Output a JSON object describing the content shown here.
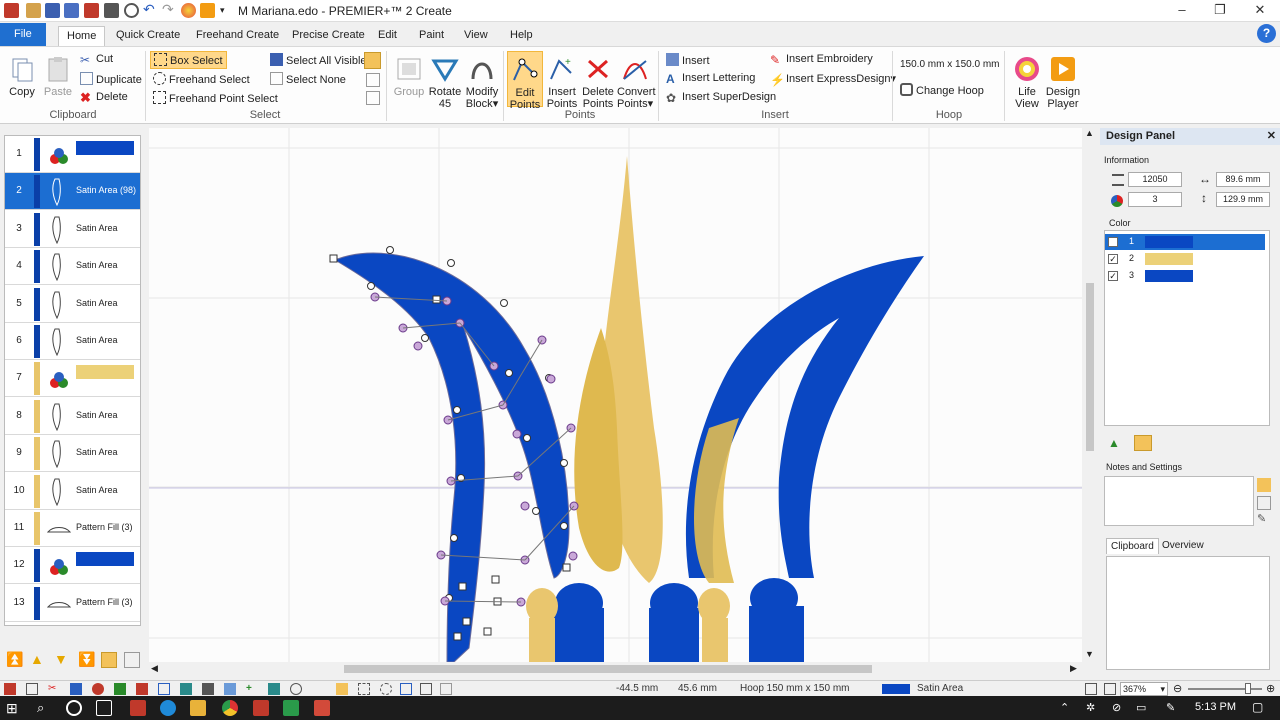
{
  "window": {
    "title": "M Mariana.edo - PREMIER+™ 2 Create",
    "minimize": "–",
    "maximize": "❐",
    "close": "✕"
  },
  "menu": {
    "tabs": [
      "File",
      "Home",
      "Quick Create",
      "Freehand Create",
      "Precise Create",
      "Edit",
      "Paint",
      "View",
      "Help"
    ],
    "help": "?"
  },
  "ribbon": {
    "clipboard": {
      "label": "Clipboard",
      "copy": "Copy",
      "paste": "Paste",
      "cut": "Cut",
      "duplicate": "Duplicate",
      "delete": "Delete"
    },
    "select": {
      "label": "Select",
      "box_select": "Box Select",
      "freehand_select": "Freehand Select",
      "freehand_point_select": "Freehand Point Select",
      "select_all_visible": "Select All Visible",
      "select_none": "Select None"
    },
    "arrange": {
      "group": "Group",
      "rotate45": [
        "Rotate",
        "45"
      ],
      "modify_block": [
        "Modify",
        "Block"
      ]
    },
    "points": {
      "label": "Points",
      "edit_points": [
        "Edit",
        "Points"
      ],
      "insert_points": [
        "Insert",
        "Points"
      ],
      "delete_points": [
        "Delete",
        "Points"
      ],
      "convert_points": [
        "Convert",
        "Points"
      ]
    },
    "insert": {
      "label": "Insert",
      "insert": "Insert",
      "insert_lettering": "Insert Lettering",
      "insert_superdesign": "Insert SuperDesign",
      "insert_embroidery": "Insert Embroidery",
      "insert_expressdesign": "Insert ExpressDesign"
    },
    "hoop": {
      "label": "Hoop",
      "size": "150.0 mm x 150.0 mm",
      "change_hoop": "Change Hoop"
    },
    "life_view": [
      "Life",
      "View"
    ],
    "design_player": [
      "Design",
      "Player"
    ]
  },
  "layers": [
    {
      "num": "1",
      "label": "",
      "bar": "#0a3fa8",
      "swatch": "#0a47c2",
      "type": "color"
    },
    {
      "num": "2",
      "label": "Satin Area (98)",
      "bar": "#0a3fa8",
      "type": "satin",
      "selected": true
    },
    {
      "num": "3",
      "label": "Satin Area",
      "bar": "#0a3fa8",
      "type": "satin"
    },
    {
      "num": "4",
      "label": "Satin Area",
      "bar": "#0a3fa8",
      "type": "satin"
    },
    {
      "num": "5",
      "label": "Satin Area",
      "bar": "#0a3fa8",
      "type": "satin"
    },
    {
      "num": "6",
      "label": "Satin Area",
      "bar": "#0a3fa8",
      "type": "satin"
    },
    {
      "num": "7",
      "label": "",
      "bar": "#e8c56a",
      "swatch": "#ecd178",
      "type": "color"
    },
    {
      "num": "8",
      "label": "Satin Area",
      "bar": "#e8c56a",
      "type": "satin"
    },
    {
      "num": "9",
      "label": "Satin Area",
      "bar": "#e8c56a",
      "type": "satin"
    },
    {
      "num": "10",
      "label": "Satin Area",
      "bar": "#e8c56a",
      "type": "satin"
    },
    {
      "num": "11",
      "label": "Pattern Fill (3)",
      "bar": "#e8c56a",
      "type": "pattern"
    },
    {
      "num": "12",
      "label": "",
      "bar": "#0a3fa8",
      "swatch": "#0a47c2",
      "type": "color"
    },
    {
      "num": "13",
      "label": "Pattern Fill (3)",
      "bar": "#0a3fa8",
      "type": "pattern"
    }
  ],
  "design_panel": {
    "title": "Design Panel",
    "information_label": "Information",
    "stitches": "12050",
    "colors": "3",
    "width": "89.6 mm",
    "height": "129.9 mm",
    "color_label": "Color",
    "color_rows": [
      {
        "num": "1",
        "color": "#0a47c2",
        "checked": "✓"
      },
      {
        "num": "2",
        "color": "#ecd178",
        "checked": "✓"
      },
      {
        "num": "3",
        "color": "#0a47c2",
        "checked": "✓"
      }
    ],
    "notes_label": "Notes and Settings",
    "tabs": [
      "Clipboard",
      "Overview"
    ]
  },
  "status": {
    "x": "-44.5 mm",
    "y": "45.6 mm",
    "hoop": "Hoop 150 mm x 150 mm",
    "object": "Satin Area",
    "object_color": "#0a47c2",
    "zoom": "367%"
  },
  "taskbar": {
    "time": "5:13 PM"
  },
  "colors": {
    "blue_thread": "#0a47c2",
    "gold_thread": "#e9c66e",
    "accent": "#1f6fd0"
  }
}
